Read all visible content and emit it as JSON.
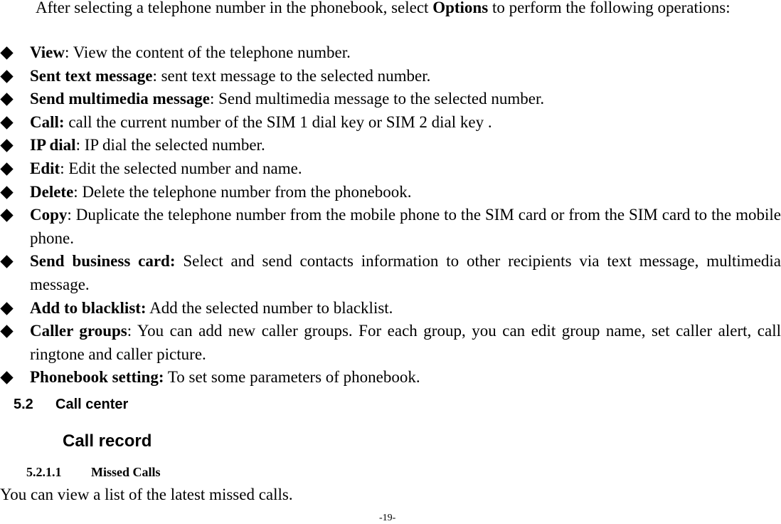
{
  "intro": {
    "text": "After selecting a telephone number in the phonebook, select ",
    "bold": "Options",
    "rest": " to perform the following operations:"
  },
  "options": [
    {
      "term": "View",
      "sep": ": ",
      "desc": "View the content of the telephone number."
    },
    {
      "term": "Sent text message",
      "sep": ": ",
      "desc": "sent text message to the selected number."
    },
    {
      "term": "Send multimedia message",
      "sep": ": ",
      "desc": "Send multimedia message to the selected number."
    },
    {
      "term": "Call:",
      "sep": " ",
      "desc": "call the current number of the SIM 1 dial key or SIM 2 dial key ."
    },
    {
      "term": "IP dial",
      "sep": ": ",
      "desc": "IP dial the selected number."
    },
    {
      "term": "Edit",
      "sep": ": ",
      "desc": "Edit the selected number and name."
    },
    {
      "term": "Delete",
      "sep": ": ",
      "desc": "Delete the telephone number from the phonebook."
    },
    {
      "term": "Copy",
      "sep": ": ",
      "desc": "Duplicate the telephone number from the mobile phone to the SIM card or from the SIM card to the mobile phone."
    },
    {
      "term": "Send business card:",
      "sep": " ",
      "desc": "Select and send contacts information to other recipients via text message, multimedia message."
    },
    {
      "term": "Add to blacklist:",
      "sep": " ",
      "desc": "Add the selected number to blacklist."
    },
    {
      "term": "Caller groups",
      "sep": ": ",
      "desc": "You can add new caller groups. For each group, you can edit group name, set caller alert, call ringtone and caller picture."
    },
    {
      "term": "Phonebook setting:",
      "sep": " ",
      "desc": "To set some parameters of phonebook."
    }
  ],
  "section": {
    "number": "5.2",
    "title": "Call center"
  },
  "subsection": {
    "title": "Call record"
  },
  "subsubsection": {
    "number": "5.2.1.1",
    "title": "Missed Calls"
  },
  "body_text": "You can view a list of the latest missed calls.",
  "page_number": "-19-"
}
